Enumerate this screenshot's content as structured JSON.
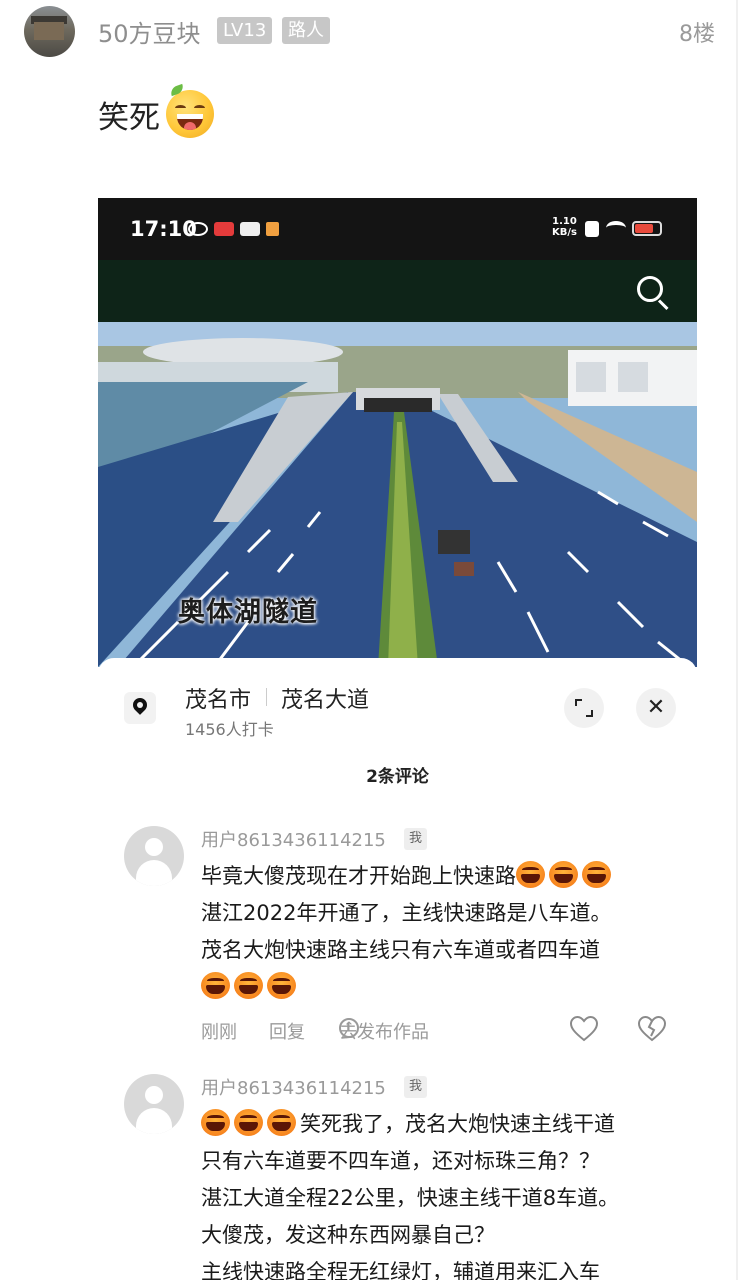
{
  "post": {
    "username": "50方豆块",
    "level_badge": "LV13",
    "role_badge": "路人",
    "floor": "8楼",
    "text": "笑死",
    "emoji_icon": "grinning-squint-emoji-icon"
  },
  "screenshot": {
    "status_bar": {
      "time": "17:10",
      "net_rate_value": "1.10",
      "net_rate_unit": "KB/s"
    },
    "photo_caption": "奥体湖隧道",
    "location": {
      "city": "茂名市",
      "road": "茂名大道",
      "checkins": "1456人打卡"
    },
    "comments_title": "2条评论",
    "comments": [
      {
        "user": "用户8613436114215",
        "me_tag": "我",
        "lines": [
          {
            "prefix_emojis": 0,
            "text": "毕竟大傻茂现在才开始跑上快速路",
            "suffix_emojis": 3
          },
          {
            "prefix_emojis": 0,
            "text": "湛江2022年开通了，主线快速路是八车道。",
            "suffix_emojis": 0
          },
          {
            "prefix_emojis": 0,
            "text": "茂名大炮快速路主线只有六车道或者四车道",
            "suffix_emojis": 0
          },
          {
            "prefix_emojis": 3,
            "text": "",
            "suffix_emojis": 0
          }
        ],
        "time": "刚刚",
        "reply": "回复",
        "share": "去发布作品"
      },
      {
        "user": "用户8613436114215",
        "me_tag": "我",
        "lines": [
          {
            "prefix_emojis": 3,
            "text": "笑死我了，茂名大炮快速主线干道",
            "suffix_emojis": 0
          },
          {
            "prefix_emojis": 0,
            "text": "只有六车道要不四车道，还对标珠三角？？",
            "suffix_emojis": 0
          },
          {
            "prefix_emojis": 0,
            "text": "湛江大道全程22公里，快速主线干道8车道。",
            "suffix_emojis": 0
          },
          {
            "prefix_emojis": 0,
            "text": "大傻茂，发这种东西网暴自己？",
            "suffix_emojis": 0
          },
          {
            "prefix_emojis": 0,
            "text": "主线快速路全程无红绿灯，辅道用来汇入车",
            "suffix_emojis": 0
          }
        ]
      }
    ]
  }
}
